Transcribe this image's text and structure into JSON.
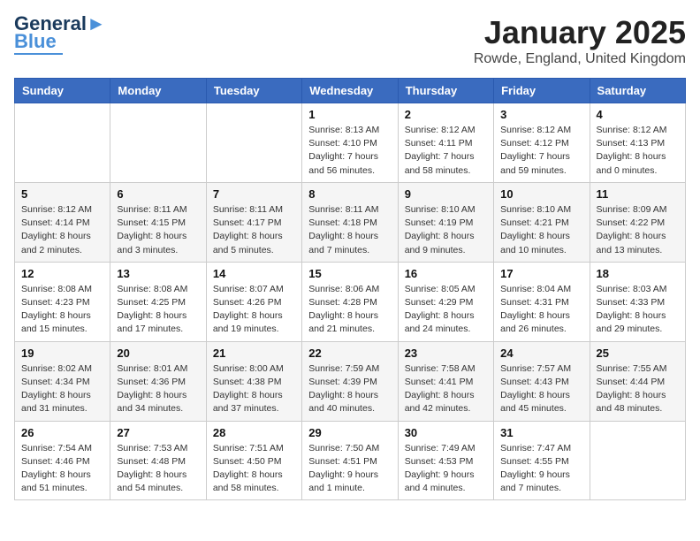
{
  "header": {
    "logo": {
      "part1": "General",
      "part2": "Blue"
    },
    "title": "January 2025",
    "subtitle": "Rowde, England, United Kingdom"
  },
  "days_of_week": [
    "Sunday",
    "Monday",
    "Tuesday",
    "Wednesday",
    "Thursday",
    "Friday",
    "Saturday"
  ],
  "weeks": [
    [
      {
        "day": "",
        "info": ""
      },
      {
        "day": "",
        "info": ""
      },
      {
        "day": "",
        "info": ""
      },
      {
        "day": "1",
        "info": "Sunrise: 8:13 AM\nSunset: 4:10 PM\nDaylight: 7 hours and 56 minutes."
      },
      {
        "day": "2",
        "info": "Sunrise: 8:12 AM\nSunset: 4:11 PM\nDaylight: 7 hours and 58 minutes."
      },
      {
        "day": "3",
        "info": "Sunrise: 8:12 AM\nSunset: 4:12 PM\nDaylight: 7 hours and 59 minutes."
      },
      {
        "day": "4",
        "info": "Sunrise: 8:12 AM\nSunset: 4:13 PM\nDaylight: 8 hours and 0 minutes."
      }
    ],
    [
      {
        "day": "5",
        "info": "Sunrise: 8:12 AM\nSunset: 4:14 PM\nDaylight: 8 hours and 2 minutes."
      },
      {
        "day": "6",
        "info": "Sunrise: 8:11 AM\nSunset: 4:15 PM\nDaylight: 8 hours and 3 minutes."
      },
      {
        "day": "7",
        "info": "Sunrise: 8:11 AM\nSunset: 4:17 PM\nDaylight: 8 hours and 5 minutes."
      },
      {
        "day": "8",
        "info": "Sunrise: 8:11 AM\nSunset: 4:18 PM\nDaylight: 8 hours and 7 minutes."
      },
      {
        "day": "9",
        "info": "Sunrise: 8:10 AM\nSunset: 4:19 PM\nDaylight: 8 hours and 9 minutes."
      },
      {
        "day": "10",
        "info": "Sunrise: 8:10 AM\nSunset: 4:21 PM\nDaylight: 8 hours and 10 minutes."
      },
      {
        "day": "11",
        "info": "Sunrise: 8:09 AM\nSunset: 4:22 PM\nDaylight: 8 hours and 13 minutes."
      }
    ],
    [
      {
        "day": "12",
        "info": "Sunrise: 8:08 AM\nSunset: 4:23 PM\nDaylight: 8 hours and 15 minutes."
      },
      {
        "day": "13",
        "info": "Sunrise: 8:08 AM\nSunset: 4:25 PM\nDaylight: 8 hours and 17 minutes."
      },
      {
        "day": "14",
        "info": "Sunrise: 8:07 AM\nSunset: 4:26 PM\nDaylight: 8 hours and 19 minutes."
      },
      {
        "day": "15",
        "info": "Sunrise: 8:06 AM\nSunset: 4:28 PM\nDaylight: 8 hours and 21 minutes."
      },
      {
        "day": "16",
        "info": "Sunrise: 8:05 AM\nSunset: 4:29 PM\nDaylight: 8 hours and 24 minutes."
      },
      {
        "day": "17",
        "info": "Sunrise: 8:04 AM\nSunset: 4:31 PM\nDaylight: 8 hours and 26 minutes."
      },
      {
        "day": "18",
        "info": "Sunrise: 8:03 AM\nSunset: 4:33 PM\nDaylight: 8 hours and 29 minutes."
      }
    ],
    [
      {
        "day": "19",
        "info": "Sunrise: 8:02 AM\nSunset: 4:34 PM\nDaylight: 8 hours and 31 minutes."
      },
      {
        "day": "20",
        "info": "Sunrise: 8:01 AM\nSunset: 4:36 PM\nDaylight: 8 hours and 34 minutes."
      },
      {
        "day": "21",
        "info": "Sunrise: 8:00 AM\nSunset: 4:38 PM\nDaylight: 8 hours and 37 minutes."
      },
      {
        "day": "22",
        "info": "Sunrise: 7:59 AM\nSunset: 4:39 PM\nDaylight: 8 hours and 40 minutes."
      },
      {
        "day": "23",
        "info": "Sunrise: 7:58 AM\nSunset: 4:41 PM\nDaylight: 8 hours and 42 minutes."
      },
      {
        "day": "24",
        "info": "Sunrise: 7:57 AM\nSunset: 4:43 PM\nDaylight: 8 hours and 45 minutes."
      },
      {
        "day": "25",
        "info": "Sunrise: 7:55 AM\nSunset: 4:44 PM\nDaylight: 8 hours and 48 minutes."
      }
    ],
    [
      {
        "day": "26",
        "info": "Sunrise: 7:54 AM\nSunset: 4:46 PM\nDaylight: 8 hours and 51 minutes."
      },
      {
        "day": "27",
        "info": "Sunrise: 7:53 AM\nSunset: 4:48 PM\nDaylight: 8 hours and 54 minutes."
      },
      {
        "day": "28",
        "info": "Sunrise: 7:51 AM\nSunset: 4:50 PM\nDaylight: 8 hours and 58 minutes."
      },
      {
        "day": "29",
        "info": "Sunrise: 7:50 AM\nSunset: 4:51 PM\nDaylight: 9 hours and 1 minute."
      },
      {
        "day": "30",
        "info": "Sunrise: 7:49 AM\nSunset: 4:53 PM\nDaylight: 9 hours and 4 minutes."
      },
      {
        "day": "31",
        "info": "Sunrise: 7:47 AM\nSunset: 4:55 PM\nDaylight: 9 hours and 7 minutes."
      },
      {
        "day": "",
        "info": ""
      }
    ]
  ]
}
